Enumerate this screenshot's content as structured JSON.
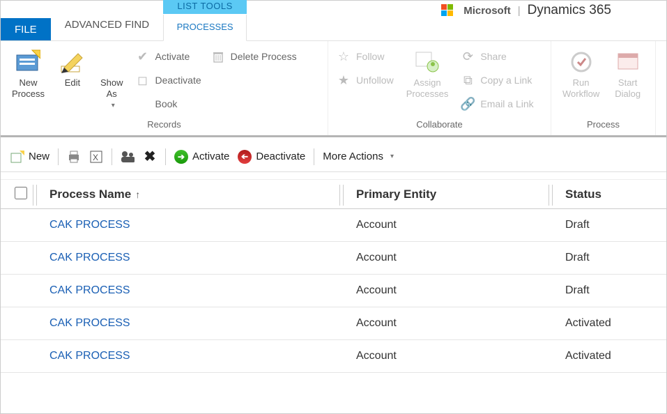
{
  "branding": {
    "ms": "Microsoft",
    "product": "Dynamics 365"
  },
  "tabs": {
    "file": "FILE",
    "advanced_find": "ADVANCED FIND",
    "contextual_header": "LIST TOOLS",
    "processes": "PROCESSES"
  },
  "ribbon": {
    "group_records_label": "Records",
    "group_collab_label": "Collaborate",
    "group_process_label": "Process",
    "new_process": "New\nProcess",
    "edit": "Edit",
    "show_as": "Show\nAs",
    "activate": "Activate",
    "deactivate": "Deactivate",
    "book": "Book",
    "delete_process": "Delete Process",
    "follow": "Follow",
    "unfollow": "Unfollow",
    "assign_processes": "Assign\nProcesses",
    "share": "Share",
    "copy_link": "Copy a Link",
    "email_link": "Email a Link",
    "run_workflow": "Run\nWorkflow",
    "start_dialog": "Start\nDialog"
  },
  "toolbar": {
    "new": "New",
    "activate": "Activate",
    "deactivate": "Deactivate",
    "more_actions": "More Actions"
  },
  "grid": {
    "columns": {
      "name": "Process Name",
      "entity": "Primary Entity",
      "status": "Status"
    },
    "rows": [
      {
        "name": "CAK PROCESS",
        "entity": "Account",
        "status": "Draft"
      },
      {
        "name": "CAK PROCESS",
        "entity": "Account",
        "status": "Draft"
      },
      {
        "name": "CAK PROCESS",
        "entity": "Account",
        "status": "Draft"
      },
      {
        "name": "CAK PROCESS",
        "entity": "Account",
        "status": "Activated"
      },
      {
        "name": "CAK PROCESS",
        "entity": "Account",
        "status": "Activated"
      }
    ]
  }
}
